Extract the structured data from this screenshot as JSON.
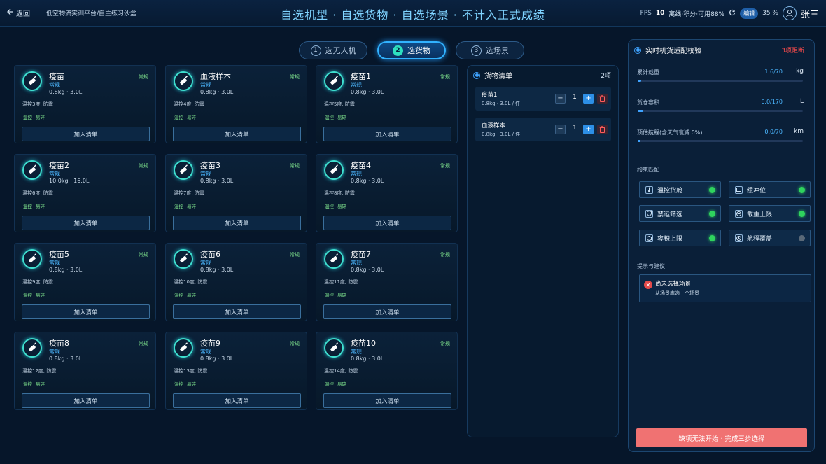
{
  "header": {
    "back_label": "返回",
    "breadcrumb": "低空物流实训平台/自主练习沙盒",
    "title": "自选机型 · 自选货物 · 自选场景 · 不计入正式成绩",
    "fps_label": "FPS",
    "fps_value": "10",
    "hud_text": "离线·积分·可用88%",
    "hud_badge": "编辑",
    "battery": "35 %",
    "username": "张三"
  },
  "steps": [
    {
      "num": "1",
      "label": "选无人机"
    },
    {
      "num": "2",
      "label": "选货物"
    },
    {
      "num": "3",
      "label": "选场景"
    }
  ],
  "cargo": [
    {
      "name": "疫苗",
      "tag": "常规",
      "type": "常规",
      "spec": "0.8kg · 3.0L",
      "desc": "温控3度, 防震",
      "t1": "温控",
      "t2": "易碎",
      "btn": "加入清单"
    },
    {
      "name": "血液样本",
      "tag": "常规",
      "type": "常规",
      "spec": "0.8kg · 3.0L",
      "desc": "温控4度, 防震",
      "t1": "温控",
      "t2": "易碎",
      "btn": "加入清单"
    },
    {
      "name": "疫苗1",
      "tag": "常规",
      "type": "常规",
      "spec": "0.8kg · 3.0L",
      "desc": "温控5度, 防震",
      "t1": "温控",
      "t2": "易碎",
      "btn": "加入清单"
    },
    {
      "name": "疫苗2",
      "tag": "常规",
      "type": "常规",
      "spec": "10.0kg · 16.0L",
      "desc": "温控6度, 防震",
      "t1": "温控",
      "t2": "易碎",
      "btn": "加入清单"
    },
    {
      "name": "疫苗3",
      "tag": "常规",
      "type": "常规",
      "spec": "0.8kg · 3.0L",
      "desc": "温控7度, 防震",
      "t1": "温控",
      "t2": "易碎",
      "btn": "加入清单"
    },
    {
      "name": "疫苗4",
      "tag": "常规",
      "type": "常规",
      "spec": "0.8kg · 3.0L",
      "desc": "温控8度, 防震",
      "t1": "温控",
      "t2": "易碎",
      "btn": "加入清单"
    },
    {
      "name": "疫苗5",
      "tag": "常规",
      "type": "常规",
      "spec": "0.8kg · 3.0L",
      "desc": "温控9度, 防震",
      "t1": "温控",
      "t2": "易碎",
      "btn": "加入清单"
    },
    {
      "name": "疫苗6",
      "tag": "常规",
      "type": "常规",
      "spec": "0.8kg · 3.0L",
      "desc": "温控10度, 防震",
      "t1": "温控",
      "t2": "易碎",
      "btn": "加入清单"
    },
    {
      "name": "疫苗7",
      "tag": "常规",
      "type": "常规",
      "spec": "0.8kg · 3.0L",
      "desc": "温控11度, 防震",
      "t1": "温控",
      "t2": "易碎",
      "btn": "加入清单"
    },
    {
      "name": "疫苗8",
      "tag": "常规",
      "type": "常规",
      "spec": "0.8kg · 3.0L",
      "desc": "温控12度, 防震",
      "t1": "温控",
      "t2": "易碎",
      "btn": "加入清单"
    },
    {
      "name": "疫苗9",
      "tag": "常规",
      "type": "常规",
      "spec": "0.8kg · 3.0L",
      "desc": "温控13度, 防震",
      "t1": "温控",
      "t2": "易碎",
      "btn": "加入清单"
    },
    {
      "name": "疫苗10",
      "tag": "常规",
      "type": "常规",
      "spec": "0.8kg · 3.0L",
      "desc": "温控14度, 防震",
      "t1": "温控",
      "t2": "易碎",
      "btn": "加入清单"
    }
  ],
  "list": {
    "title": "货物清单",
    "count": "2项",
    "items": [
      {
        "name": "疫苗1",
        "spec": "0.8kg · 3.0L / 件",
        "qty": "1"
      },
      {
        "name": "血液样本",
        "spec": "0.8kg · 3.0L / 件",
        "qty": "1"
      }
    ]
  },
  "validation": {
    "title": "实时机货适配校验",
    "warning": "3项阻断",
    "metrics": [
      {
        "label": "累计载重",
        "value": "1.6/70",
        "unit": "kg",
        "fraction": 0.023
      },
      {
        "label": "货仓容积",
        "value": "6.0/170",
        "unit": "L",
        "fraction": 0.035
      },
      {
        "label": "预估航程(含天气衰减 0%)",
        "value": "0.0/70",
        "unit": "km",
        "fraction": 0.0
      }
    ],
    "constraints_label": "约束匹配",
    "constraints": [
      {
        "label": "温控货舱",
        "status": "ok"
      },
      {
        "label": "缓冲位",
        "status": "ok"
      },
      {
        "label": "禁运筛选",
        "status": "ok"
      },
      {
        "label": "载重上限",
        "status": "ok"
      },
      {
        "label": "容积上限",
        "status": "ok"
      },
      {
        "label": "航程覆盖",
        "status": "idle"
      }
    ],
    "tips_label": "提示与建议",
    "tip_title": "尚未选择场景",
    "tip_body": "从场景库选一个场景",
    "start_label": "缺项无法开始 · 完成三步选择"
  },
  "colors": {
    "accent": "#31b2ff",
    "ok": "#2fd35e",
    "danger": "#f07272",
    "teal": "#3fe0d0"
  }
}
